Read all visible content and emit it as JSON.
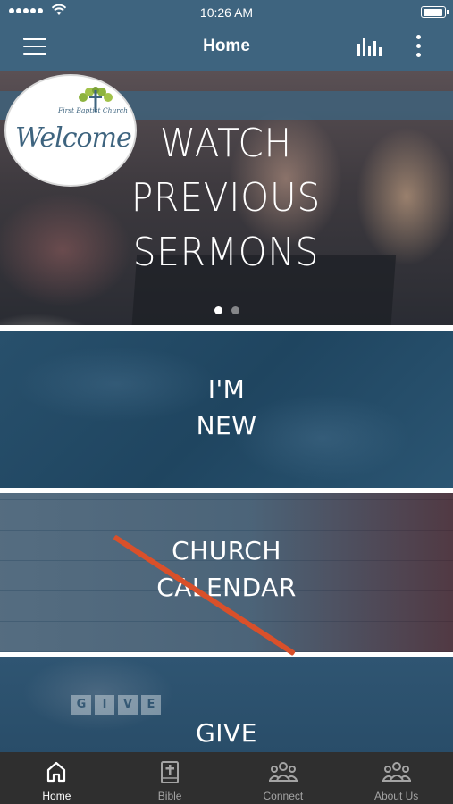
{
  "status_bar": {
    "time": "10:26 AM",
    "signal_bars": 5,
    "battery_level": 0.85,
    "icons": [
      "signal-dots",
      "wifi-icon",
      "battery-icon"
    ]
  },
  "nav": {
    "title": "Home",
    "icons": [
      "hamburger-menu-icon",
      "audio-bars-icon",
      "more-vertical-icon"
    ]
  },
  "hero": {
    "title_lines": [
      "WATCH",
      "PREVIOUS",
      "SERMONS"
    ],
    "logo": {
      "church_name": "First Baptist Church",
      "welcome": "Welcome"
    },
    "carousel": {
      "total": 2,
      "active": 1
    }
  },
  "tiles": [
    {
      "lines": [
        "I'M",
        "NEW"
      ]
    },
    {
      "lines": [
        "CHURCH",
        "CALENDAR"
      ]
    },
    {
      "lines": [
        "GIVE"
      ],
      "blocks": [
        "G",
        "I",
        "V",
        "E"
      ]
    }
  ],
  "tab_bar": {
    "active": 0,
    "tabs": [
      {
        "label": "Home",
        "icon": "home-icon"
      },
      {
        "label": "Bible",
        "icon": "bible-icon"
      },
      {
        "label": "Connect",
        "icon": "people-icon"
      },
      {
        "label": "About Us",
        "icon": "people-icon"
      }
    ]
  },
  "colors": {
    "header": "#3e647f",
    "tab_bar": "#2f2f2f",
    "tab_active": "#ffffff",
    "tab_inactive": "#a4a4a4"
  }
}
